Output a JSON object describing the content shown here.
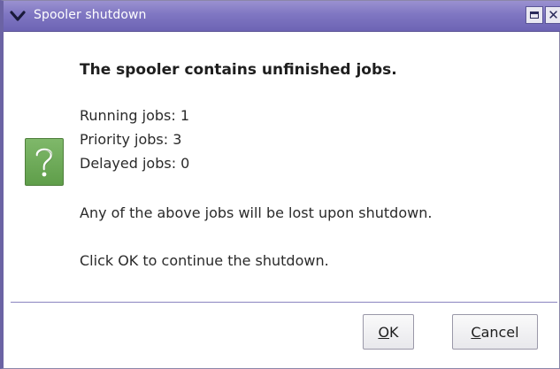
{
  "window": {
    "title": "Spooler shutdown"
  },
  "dialog": {
    "heading": "The spooler contains unfinished jobs.",
    "running_jobs": "Running jobs: 1",
    "priority_jobs": "Priority jobs: 3",
    "delayed_jobs": "Delayed jobs: 0",
    "warning": "Any of the above jobs will be lost upon shutdown.",
    "instruction": "Click OK to continue the shutdown.",
    "icon": "question-icon"
  },
  "buttons": {
    "ok_mnemonic": "O",
    "ok_rest": "K",
    "cancel_mnemonic": "C",
    "cancel_rest": "ancel"
  },
  "colors": {
    "titlebar": "#7f76c2",
    "icon_bg": "#5f9e4a",
    "separator": "#8a84c0"
  }
}
